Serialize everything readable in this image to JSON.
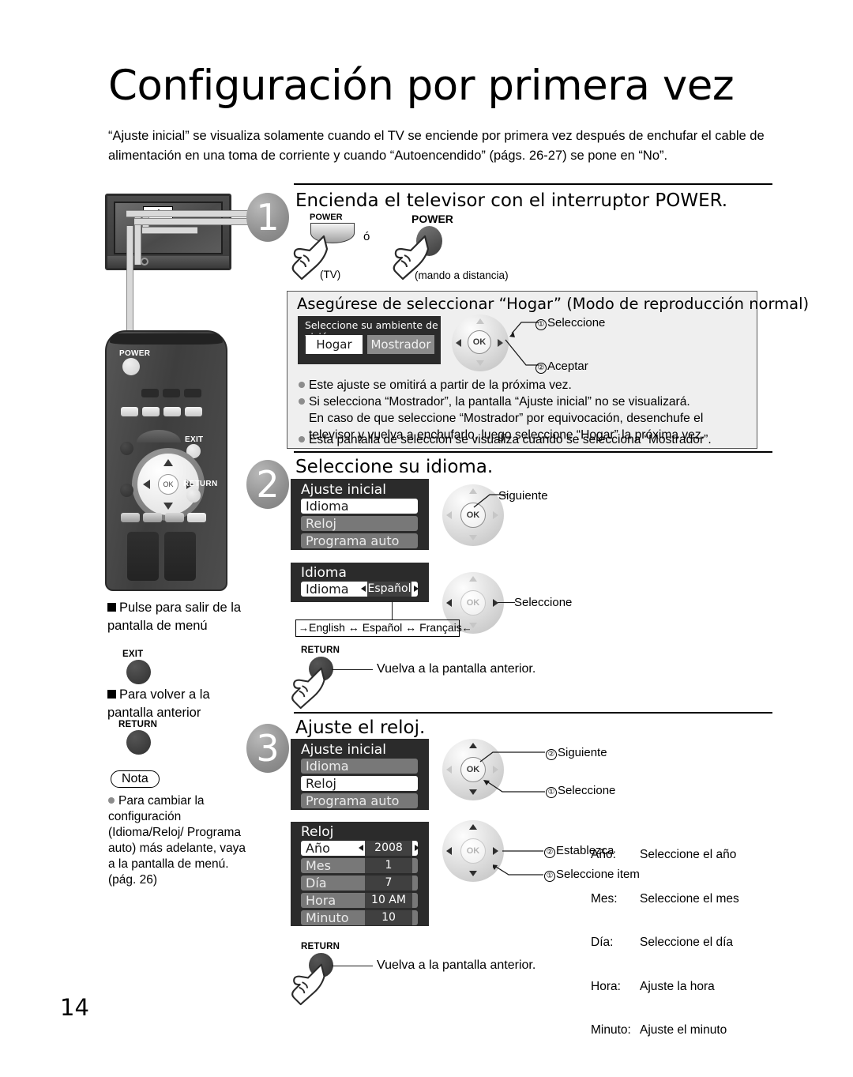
{
  "page": {
    "title": "Configuración por primera vez",
    "intro": "“Ajuste inicial” se visualiza solamente cuando el TV se enciende por primera vez después de enchufar el cable de alimentación en una toma de corriente y cuando “Autoencendido” (págs. 26-27) se pone en “No”.",
    "page_number": "14"
  },
  "illustration": {
    "tv_power_mark": "ó",
    "remote_power_label": "POWER",
    "remote_exit_label": "EXIT",
    "remote_return_label": "RETURN",
    "remote_ok_label": "OK"
  },
  "step1": {
    "number": "1",
    "heading": "Encienda el televisor con el interruptor POWER.",
    "tv_button_label": "POWER",
    "tv_caption": "(TV)",
    "or": "ó",
    "remote_button_label": "POWER",
    "remote_caption": "(mando a distancia)",
    "panel": {
      "heading": "Asegúrese de seleccionar “Hogar” (Modo de reproducción normal)",
      "osd_title": "Seleccione su ambiente de visión",
      "option_home": "Hogar",
      "option_store": "Mostrador",
      "callouts": [
        {
          "num": "①",
          "label": "Seleccione"
        },
        {
          "num": "②",
          "label": "Aceptar"
        }
      ],
      "bullets": [
        "Este ajuste se omitirá a partir de la próxima vez.",
        "Si selecciona “Mostrador”, la pantalla “Ajuste inicial” no se visualizará.",
        "En caso de que seleccione “Mostrador” por equivocación, desenchufe el",
        "televisor y vuelva a enchufarlo, luego seleccione “Hogar” la próxima vez.",
        "Esta pantalla de selección se visualiza cuando se selecciona “Mostrador”."
      ]
    }
  },
  "step2": {
    "number": "2",
    "heading": "Seleccione su idioma.",
    "menu1": {
      "title": "Ajuste inicial",
      "rows": [
        {
          "label": "Idioma",
          "selected": true
        },
        {
          "label": "Reloj",
          "selected": false
        },
        {
          "label": "Programa auto",
          "selected": false
        }
      ]
    },
    "callout1": "Siguiente",
    "menu2": {
      "title": "Idioma",
      "row_label": "Idioma",
      "row_value": "Español"
    },
    "callout2": "Seleccione",
    "language_cycle": "English ↔ Español ↔ Français",
    "return": {
      "key": "RETURN",
      "text": "Vuelva a la pantalla anterior."
    }
  },
  "step3": {
    "number": "3",
    "heading": "Ajuste el reloj.",
    "menu1": {
      "title": "Ajuste inicial",
      "rows": [
        {
          "label": "Idioma",
          "selected": false
        },
        {
          "label": "Reloj",
          "selected": true
        },
        {
          "label": "Programa auto",
          "selected": false
        }
      ]
    },
    "callouts1": [
      {
        "num": "②",
        "label": "Siguiente"
      },
      {
        "num": "①",
        "label": "Seleccione"
      }
    ],
    "menu2": {
      "title": "Reloj",
      "rows": [
        {
          "label": "Año",
          "value": "2008",
          "selected": true
        },
        {
          "label": "Mes",
          "value": "1",
          "selected": false
        },
        {
          "label": "Día",
          "value": "7",
          "selected": false
        },
        {
          "label": "Hora",
          "value": "10 AM",
          "selected": false
        },
        {
          "label": "Minuto",
          "value": "10",
          "selected": false
        }
      ]
    },
    "callouts2": [
      {
        "num": "②",
        "label": "Establezca"
      },
      {
        "num": "①",
        "label": "Seleccione item"
      }
    ],
    "legend": [
      {
        "key": "Año:",
        "desc": "Seleccione el año"
      },
      {
        "key": "Mes:",
        "desc": "Seleccione el mes"
      },
      {
        "key": "Día:",
        "desc": "Seleccione el día"
      },
      {
        "key": "Hora:",
        "desc": "Ajuste la hora"
      },
      {
        "key": "Minuto:",
        "desc": "Ajuste el minuto"
      }
    ],
    "return": {
      "key": "RETURN",
      "text": "Vuelva a la pantalla anterior."
    }
  },
  "sidebar": {
    "exit_note": "Pulse para salir de la pantalla de menú",
    "exit_key": "EXIT",
    "return_note": "Para volver a la pantalla anterior",
    "return_key": "RETURN",
    "note_label": "Nota",
    "note_text": "Para cambiar la configuración (Idioma/Reloj/ Programa auto) más adelante, vaya a la pantalla de menú. (pág. 26)"
  }
}
